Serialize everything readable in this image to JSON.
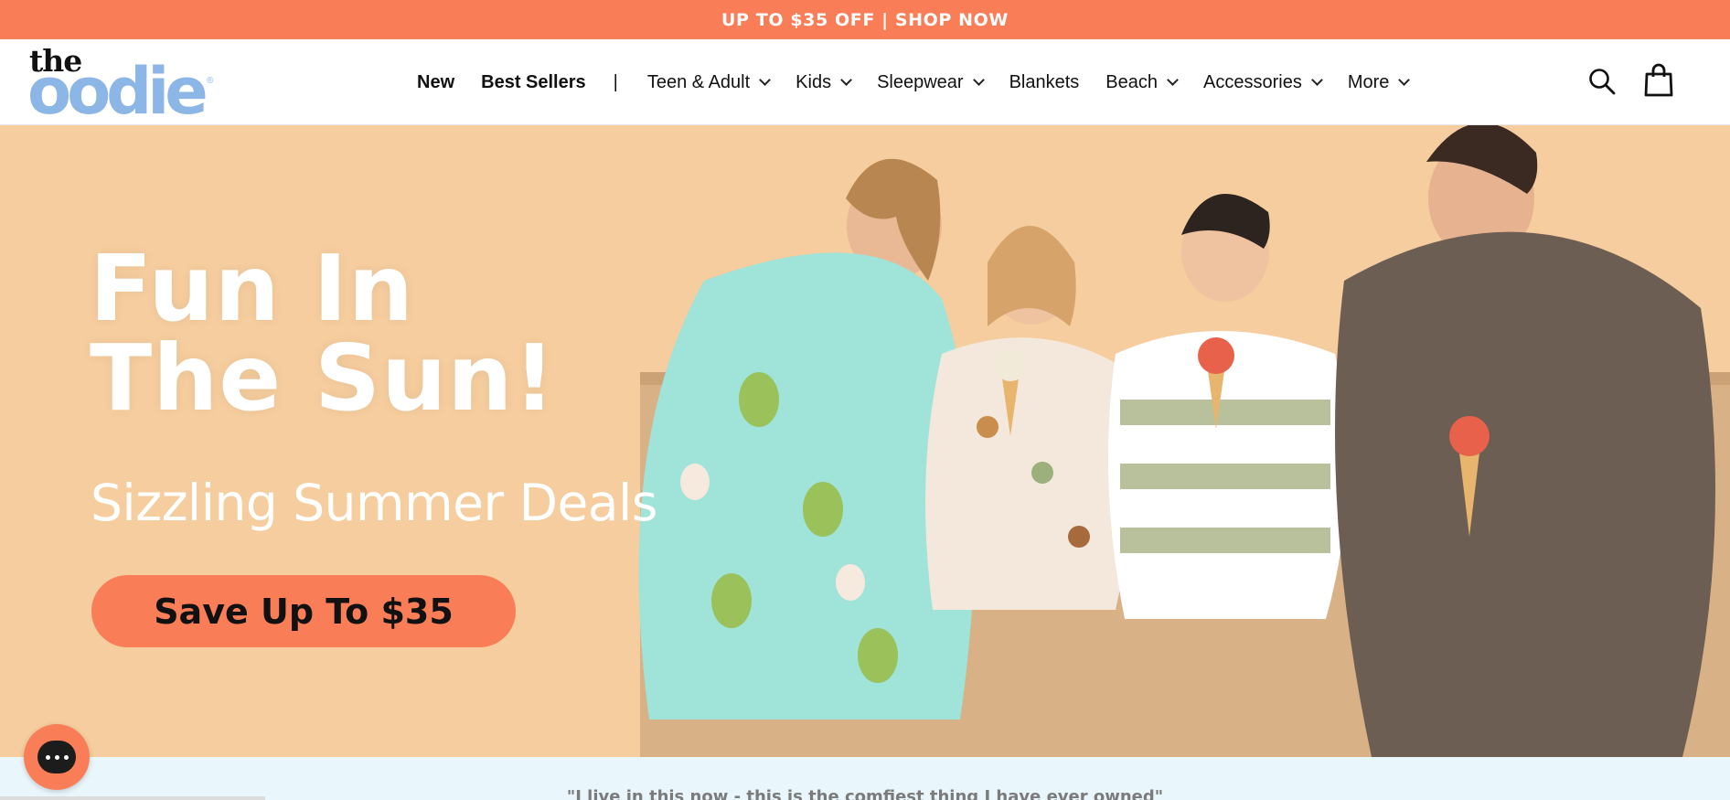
{
  "announcement": {
    "text": "UP TO $35 OFF | SHOP NOW"
  },
  "logo": {
    "top": "the",
    "brand": "oodie",
    "reg": "®"
  },
  "nav": {
    "items": [
      {
        "label": "New",
        "bold": true,
        "dropdown": false
      },
      {
        "label": "Best Sellers",
        "bold": true,
        "dropdown": false
      },
      {
        "label": "Teen & Adult",
        "bold": false,
        "dropdown": true
      },
      {
        "label": "Kids",
        "bold": false,
        "dropdown": true
      },
      {
        "label": "Sleepwear",
        "bold": false,
        "dropdown": true
      },
      {
        "label": "Blankets",
        "bold": false,
        "dropdown": false
      },
      {
        "label": "Beach",
        "bold": false,
        "dropdown": true
      },
      {
        "label": "Accessories",
        "bold": false,
        "dropdown": true
      },
      {
        "label": "More",
        "bold": false,
        "dropdown": true
      }
    ],
    "separator": "|"
  },
  "icons": {
    "search": "search-icon",
    "cart": "shopping-bag-icon",
    "chat": "chat-icon"
  },
  "hero": {
    "title_line1": "Fun In",
    "title_line2": "The Sun!",
    "subtitle": "Sizzling Summer Deals",
    "cta": "Save Up To $35"
  },
  "review": {
    "text": "\"I live in this now - this is the comfiest thing I have ever owned\""
  },
  "colors": {
    "accent": "#f97e57",
    "logo_blue": "#8cb6e5",
    "hero_bg": "#f5cd9e",
    "review_bg": "#e9f6fb",
    "towel_mint": "#9fe3d9",
    "towel_brown": "#6d5e53",
    "towel_sage": "#b9c09c"
  }
}
